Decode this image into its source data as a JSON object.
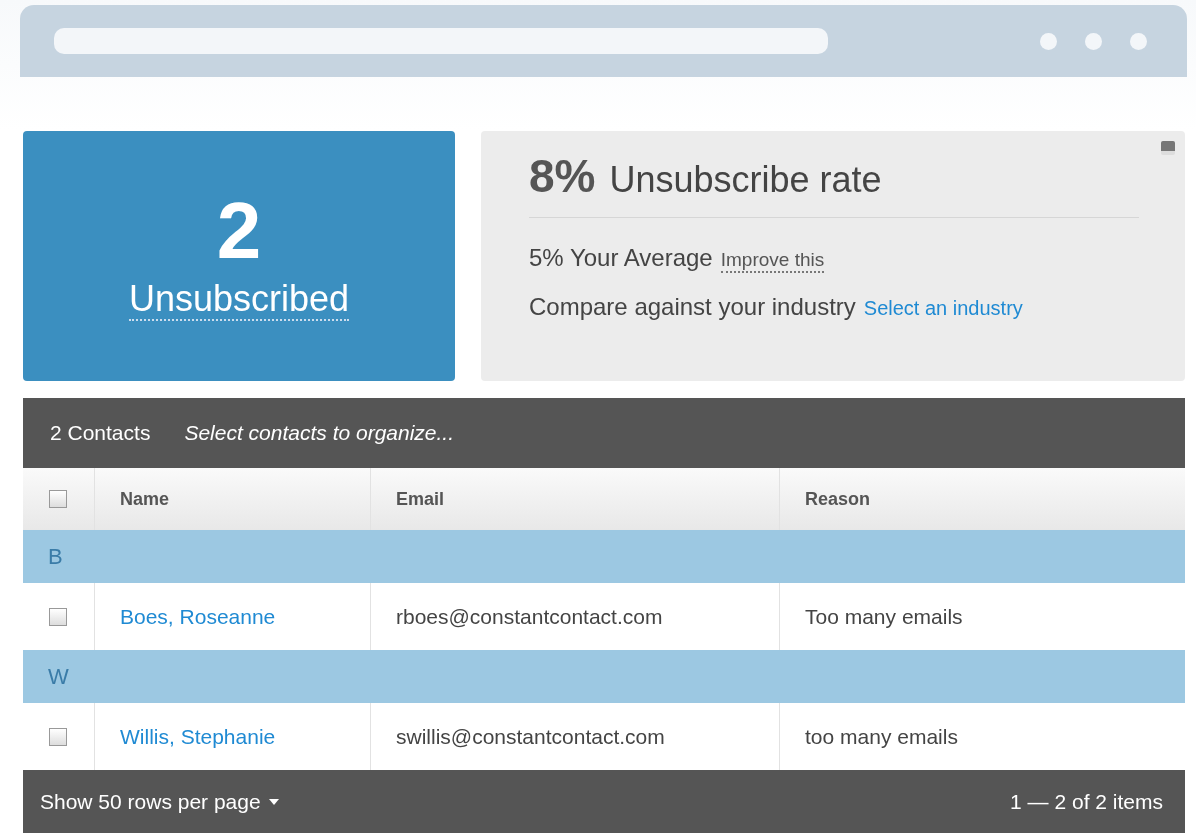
{
  "summary": {
    "count": "2",
    "label": "Unsubscribed"
  },
  "rate": {
    "value": "8%",
    "label": "Unsubscribe rate",
    "average": "5% Your Average",
    "average_link": "Improve this",
    "compare": "Compare against your industry",
    "compare_link": "Select an industry"
  },
  "toolbar": {
    "count": "2 Contacts",
    "hint": "Select contacts to organize..."
  },
  "table": {
    "select_all_checked": false,
    "columns": [
      "Name",
      "Email",
      "Reason"
    ],
    "groups": [
      {
        "letter": "B",
        "rows": [
          {
            "name": "Boes, Roseanne",
            "email": "rboes@constantcontact.com",
            "reason": "Too many emails",
            "checked": false
          }
        ]
      },
      {
        "letter": "W",
        "rows": [
          {
            "name": "Willis, Stephanie",
            "email": "swillis@constantcontact.com",
            "reason": "too many emails",
            "checked": false
          }
        ]
      }
    ]
  },
  "footer": {
    "rows_per_page": "Show 50 rows per page",
    "range": "1 — 2 of 2 items"
  }
}
